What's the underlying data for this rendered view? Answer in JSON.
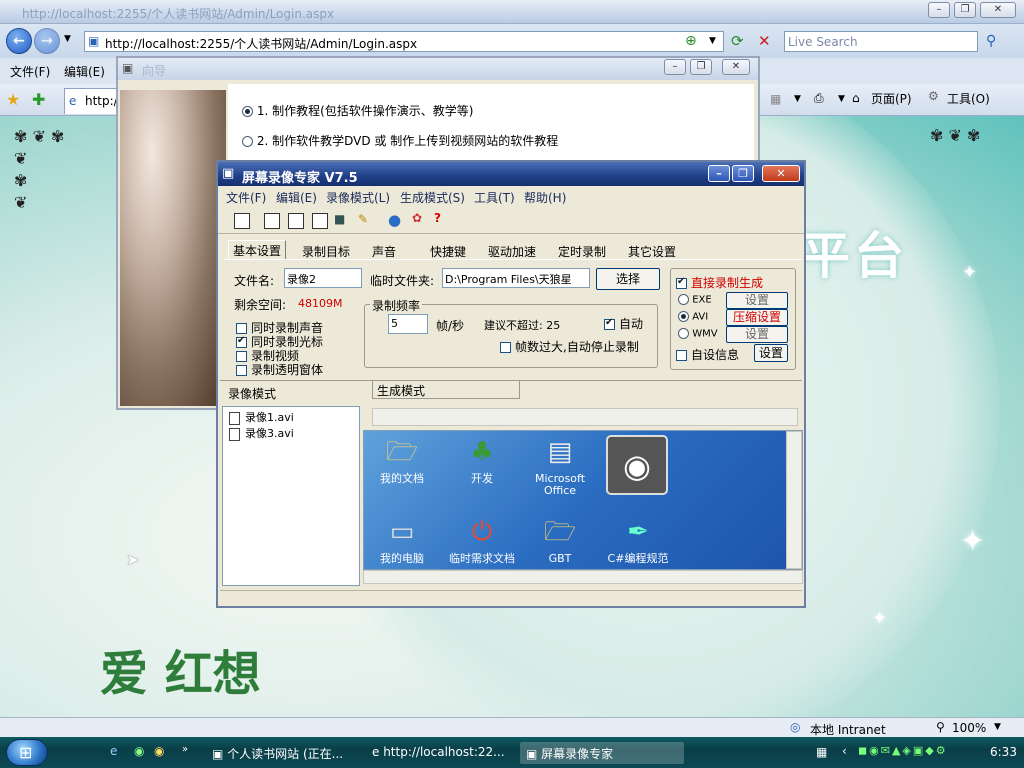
{
  "ie": {
    "title": "http://localhost:2255/个人读书网站/Admin/Login.aspx",
    "address": "http://localhost:2255/个人读书网站/Admin/Login.aspx",
    "search_placeholder": "Live Search",
    "menu": [
      "文件(F)",
      "编辑(E)"
    ],
    "tab_label": "http://",
    "toolbar_right": [
      "页面(P)",
      "工具(O)"
    ]
  },
  "page": {
    "title_fragment": "平台",
    "logo_fragment": "爱 红想",
    "status_zone": "本地 Intranet",
    "zoom": "100%"
  },
  "dialog": {
    "title": "向导",
    "option1": "1. 制作教程(包括软件操作演示、教学等)",
    "option2": "2. 制作软件教学DVD 或 制作上传到视频网站的软件教程"
  },
  "app": {
    "title": "屏幕录像专家 V7.5",
    "menu": [
      "文件(F)",
      "编辑(E)",
      "录像模式(L)",
      "生成模式(S)",
      "工具(T)",
      "帮助(H)"
    ],
    "tabs": [
      "基本设置",
      "录制目标",
      "声音",
      "快捷键",
      "驱动加速",
      "定时录制",
      "其它设置"
    ],
    "filename_label": "文件名:",
    "filename_value": "录像2",
    "tempdir_label": "临时文件夹:",
    "tempdir_value": "D:\\Program Files\\天狼星",
    "choose_button": "选择",
    "space_label": "剩余空间:",
    "space_value": "48109M",
    "checks": [
      "同时录制声音",
      "同时录制光标",
      "录制视频",
      "录制透明窗体"
    ],
    "freq_group": "录制频率",
    "fps_value": "5",
    "fps_unit": "帧/秒",
    "suggest": "建议不超过: 25",
    "auto": "自动",
    "auto_stop": "帧数过大,自动停止录制",
    "direct_record": "直接录制生成",
    "formats": [
      "EXE",
      "AVI",
      "WMV"
    ],
    "format_buttons": [
      "设置",
      "压缩设置",
      "设置"
    ],
    "custom_info": "自设信息",
    "custom_button": "设置",
    "record_mode_label": "录像模式",
    "gen_mode_label": "生成模式",
    "files": [
      "录像1.avi",
      "录像3.avi"
    ],
    "desktop_icons": [
      "我的文档",
      "开发",
      "Microsoft Office",
      "我的电脑",
      "临时需求文档",
      "GBT",
      "C#编程规范"
    ]
  },
  "taskbar": {
    "tasks": [
      "个人读书网站 (正在...",
      "http://localhost:22...",
      "屏幕录像专家"
    ],
    "clock": "6:33"
  },
  "colors": {
    "accent": "#1f3f87",
    "red_text": "#d00000"
  }
}
